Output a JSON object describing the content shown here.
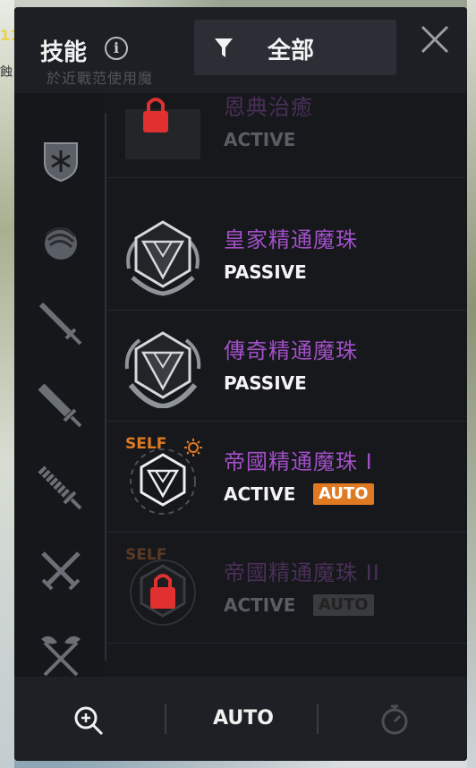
{
  "background": {
    "text1": "11",
    "text2": "蝕"
  },
  "header": {
    "title": "技能",
    "info_icon": "info-icon",
    "filter_label": "全部",
    "ghost_text": "於近戰范使用魔"
  },
  "sidebar": {
    "items": [
      "shield-icon",
      "orb-icon",
      "sword-icon",
      "broadsword-icon",
      "serrated-sword-icon",
      "crossed-swords-icon",
      "crossed-axes-icon"
    ]
  },
  "skills": [
    {
      "name": "恩典治癒",
      "type": "ACTIVE",
      "locked": true,
      "auto": "",
      "self": ""
    },
    {
      "name": "皇家精通魔珠",
      "type": "PASSIVE",
      "locked": false,
      "auto": "",
      "self": ""
    },
    {
      "name": "傳奇精通魔珠",
      "type": "PASSIVE",
      "locked": false,
      "auto": "",
      "self": ""
    },
    {
      "name": "帝國精通魔珠 I",
      "type": "ACTIVE",
      "locked": false,
      "auto": "AUTO",
      "self": "SELF"
    },
    {
      "name": "帝國精通魔珠 II",
      "type": "ACTIVE",
      "locked": true,
      "auto": "AUTO",
      "self": "SELF"
    }
  ],
  "footer": {
    "auto_label": "AUTO"
  },
  "colors": {
    "accent": "#e07a22",
    "skill_name": "#a24fc7",
    "panel": "#16181c",
    "lock": "#e03030"
  }
}
